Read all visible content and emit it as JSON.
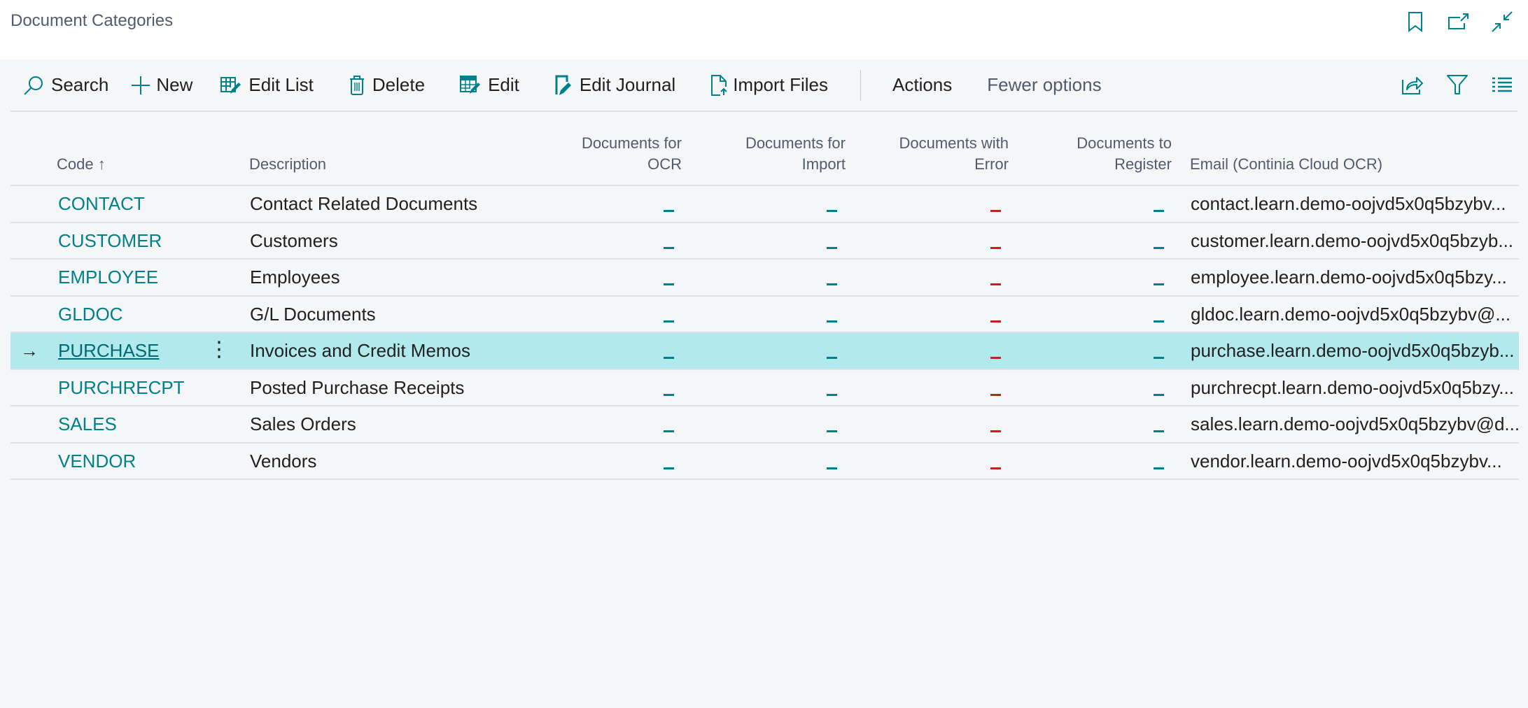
{
  "header": {
    "title": "Document Categories",
    "icons": [
      "bookmark-icon",
      "open-in-new-window-icon",
      "collapse-icon"
    ]
  },
  "toolbar": {
    "search_label": "Search",
    "new_label": "New",
    "edit_list_label": "Edit List",
    "delete_label": "Delete",
    "edit_label": "Edit",
    "edit_journal_label": "Edit Journal",
    "import_files_label": "Import Files",
    "actions_label": "Actions",
    "fewer_options_label": "Fewer options",
    "right_icons": [
      "share-icon",
      "filter-icon",
      "list-view-icon"
    ]
  },
  "colors": {
    "accent": "#00808a",
    "selected_row": "#b2e9ec",
    "error_dash": "#c0241c",
    "background": "#f5f6f8"
  },
  "table": {
    "columns": {
      "code": "Code",
      "code_sort": "↑",
      "description": "Description",
      "ocr_line1": "Documents for",
      "ocr_line2": "OCR",
      "import_line1": "Documents for",
      "import_line2": "Import",
      "error_line1": "Documents with",
      "error_line2": "Error",
      "register_line1": "Documents to",
      "register_line2": "Register",
      "email": "Email (Continia Cloud OCR)"
    },
    "rows": [
      {
        "code": "CONTACT",
        "description": "Contact Related Documents",
        "ocr": "_",
        "import": "_",
        "error": "_",
        "register": "_",
        "email": "contact.learn.demo-oojvd5x0q5bzybv..."
      },
      {
        "code": "CUSTOMER",
        "description": "Customers",
        "ocr": "_",
        "import": "_",
        "error": "_",
        "register": "_",
        "email": "customer.learn.demo-oojvd5x0q5bzyb..."
      },
      {
        "code": "EMPLOYEE",
        "description": "Employees",
        "ocr": "_",
        "import": "_",
        "error": "_",
        "register": "_",
        "email": "employee.learn.demo-oojvd5x0q5bzy..."
      },
      {
        "code": "GLDOC",
        "description": "G/L Documents",
        "ocr": "_",
        "import": "_",
        "error": "_",
        "register": "_",
        "email": "gldoc.learn.demo-oojvd5x0q5bzybv@..."
      },
      {
        "code": "PURCHASE",
        "description": "Invoices and Credit Memos",
        "ocr": "_",
        "import": "_",
        "error": "_",
        "register": "_",
        "email": "purchase.learn.demo-oojvd5x0q5bzyb...",
        "selected": true
      },
      {
        "code": "PURCHRECPT",
        "description": "Posted Purchase Receipts",
        "ocr": "_",
        "import": "_",
        "error": "_",
        "register": "_",
        "email": "purchrecpt.learn.demo-oojvd5x0q5bzy..."
      },
      {
        "code": "SALES",
        "description": "Sales Orders",
        "ocr": "_",
        "import": "_",
        "error": "_",
        "register": "_",
        "email": "sales.learn.demo-oojvd5x0q5bzybv@d..."
      },
      {
        "code": "VENDOR",
        "description": "Vendors",
        "ocr": "_",
        "import": "_",
        "error": "_",
        "register": "_",
        "email": "vendor.learn.demo-oojvd5x0q5bzybv..."
      }
    ],
    "selected_marker": "→",
    "row_menu": "⋮"
  }
}
